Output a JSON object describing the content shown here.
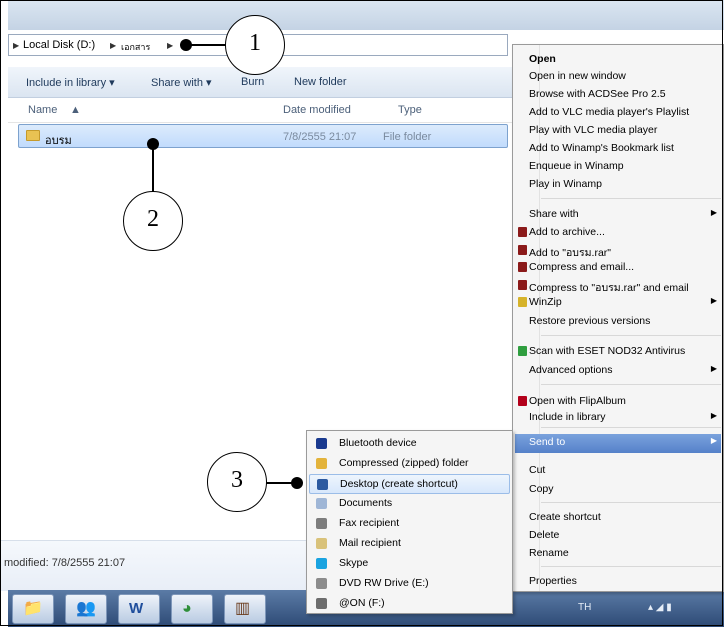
{
  "breadcrumb": {
    "root": "Local Disk (D:)",
    "folder": "เอกสาร"
  },
  "toolbar": {
    "include_in_library": "Include in library ▾",
    "share_with": "Share with ▾",
    "burn": "Burn",
    "new_folder": "New folder"
  },
  "columns": {
    "name": "Name",
    "date_modified": "Date modified",
    "type": "Type"
  },
  "file_row": {
    "name": "อบรม",
    "date": "7/8/2555 21:07",
    "type": "File folder"
  },
  "details": {
    "modified": "modified: 7/8/2555 21:07"
  },
  "context_menu": {
    "items": [
      {
        "label": "Open",
        "bold": true
      },
      {
        "label": "Open in new window"
      },
      {
        "label": "Browse with ACDSee Pro 2.5"
      },
      {
        "label": "Add to VLC media player's Playlist"
      },
      {
        "label": "Play with VLC media player"
      },
      {
        "label": "Add to Winamp's Bookmark list"
      },
      {
        "label": "Enqueue in Winamp"
      },
      {
        "label": "Play in Winamp"
      },
      {
        "label": "Share with",
        "submenu": true
      },
      {
        "label": "Add to archive..."
      },
      {
        "label": "Add to \"อบรม.rar\""
      },
      {
        "label": "Compress and email..."
      },
      {
        "label": "Compress to \"อบรม.rar\" and email"
      },
      {
        "label": "WinZip",
        "submenu": true
      },
      {
        "label": "Restore previous versions"
      },
      {
        "label": "Scan with ESET NOD32 Antivirus"
      },
      {
        "label": "Advanced options",
        "submenu": true
      },
      {
        "label": "Open with FlipAlbum"
      },
      {
        "label": "Include in library",
        "submenu": true
      },
      {
        "label": "Send to",
        "submenu": true,
        "highlighted": true
      },
      {
        "label": "Cut"
      },
      {
        "label": "Copy"
      },
      {
        "label": "Create shortcut"
      },
      {
        "label": "Delete"
      },
      {
        "label": "Rename"
      },
      {
        "label": "Properties"
      }
    ]
  },
  "send_to_menu": {
    "items": [
      {
        "label": "Bluetooth device",
        "icon": "bluetooth-icon"
      },
      {
        "label": "Compressed (zipped) folder",
        "icon": "zip-folder-icon"
      },
      {
        "label": "Desktop (create shortcut)",
        "icon": "desktop-icon",
        "highlighted": true
      },
      {
        "label": "Documents",
        "icon": "documents-icon"
      },
      {
        "label": "Fax recipient",
        "icon": "fax-icon"
      },
      {
        "label": "Mail recipient",
        "icon": "mail-icon"
      },
      {
        "label": "Skype",
        "icon": "skype-icon"
      },
      {
        "label": "DVD RW Drive (E:)",
        "icon": "dvd-drive-icon"
      },
      {
        "label": "@ON (F:)",
        "icon": "usb-drive-icon"
      }
    ]
  },
  "callouts": [
    "1",
    "2",
    "3"
  ],
  "tray": {
    "language": "TH"
  },
  "colors": {
    "highlight": "#5581c9",
    "selection": "#c1dbfc"
  }
}
